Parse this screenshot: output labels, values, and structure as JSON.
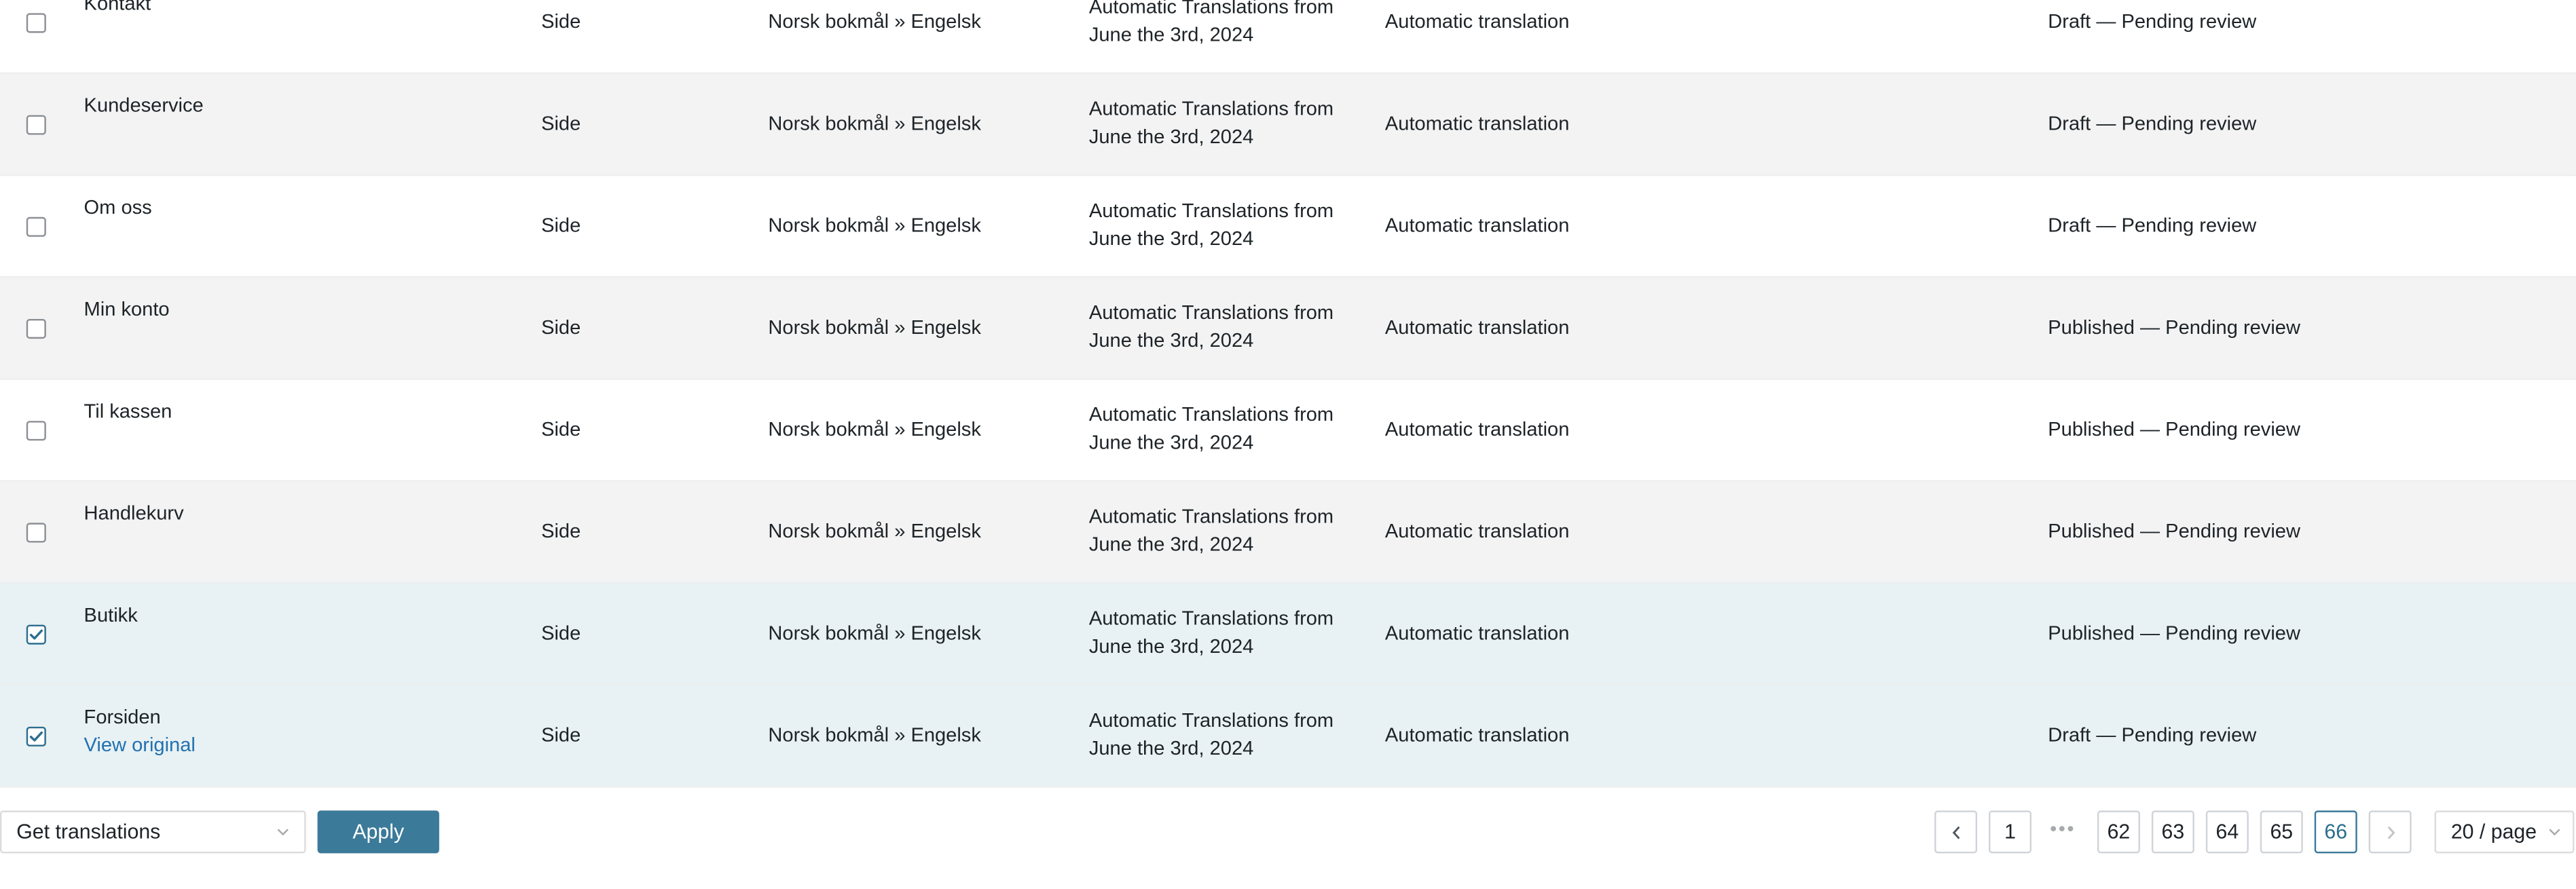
{
  "rows": [
    {
      "title": "Kontakt",
      "type": "Side",
      "language": "Norsk bokmål » Engelsk",
      "job_line1": "Automatic Translations from",
      "job_line2": "June the 3rd, 2024",
      "method": "Automatic translation",
      "status": "Draft — Pending review",
      "checked": false
    },
    {
      "title": "Kundeservice",
      "type": "Side",
      "language": "Norsk bokmål » Engelsk",
      "job_line1": "Automatic Translations from",
      "job_line2": "June the 3rd, 2024",
      "method": "Automatic translation",
      "status": "Draft — Pending review",
      "checked": false
    },
    {
      "title": "Om oss",
      "type": "Side",
      "language": "Norsk bokmål » Engelsk",
      "job_line1": "Automatic Translations from",
      "job_line2": "June the 3rd, 2024",
      "method": "Automatic translation",
      "status": "Draft — Pending review",
      "checked": false
    },
    {
      "title": "Min konto",
      "type": "Side",
      "language": "Norsk bokmål » Engelsk",
      "job_line1": "Automatic Translations from",
      "job_line2": "June the 3rd, 2024",
      "method": "Automatic translation",
      "status": "Published — Pending review",
      "checked": false
    },
    {
      "title": "Til kassen",
      "type": "Side",
      "language": "Norsk bokmål » Engelsk",
      "job_line1": "Automatic Translations from",
      "job_line2": "June the 3rd, 2024",
      "method": "Automatic translation",
      "status": "Published — Pending review",
      "checked": false
    },
    {
      "title": "Handlekurv",
      "type": "Side",
      "language": "Norsk bokmål » Engelsk",
      "job_line1": "Automatic Translations from",
      "job_line2": "June the 3rd, 2024",
      "method": "Automatic translation",
      "status": "Published — Pending review",
      "checked": false
    },
    {
      "title": "Butikk",
      "type": "Side",
      "language": "Norsk bokmål » Engelsk",
      "job_line1": "Automatic Translations from",
      "job_line2": "June the 3rd, 2024",
      "method": "Automatic translation",
      "status": "Published — Pending review",
      "checked": true
    },
    {
      "title": "Forsiden",
      "view_original": "View original",
      "type": "Side",
      "language": "Norsk bokmål » Engelsk",
      "job_line1": "Automatic Translations from",
      "job_line2": "June the 3rd, 2024",
      "method": "Automatic translation",
      "status": "Draft — Pending review",
      "checked": true
    }
  ],
  "footer": {
    "bulk_action": {
      "selected": "Get translations",
      "icon": "chevron-down-icon"
    },
    "apply_label": "Apply",
    "pagination": {
      "prev_icon": "chevron-left-icon",
      "next_icon": "chevron-right-icon",
      "first": "1",
      "ellipsis": "•••",
      "pages": [
        "62",
        "63",
        "64",
        "65",
        "66"
      ],
      "current": "66"
    },
    "per_page": "20 / page"
  },
  "colors": {
    "accent": "#3b7a99",
    "link": "#2271b1",
    "selected_row": "#e8f1f3",
    "alt_row": "#f3f3f3"
  }
}
